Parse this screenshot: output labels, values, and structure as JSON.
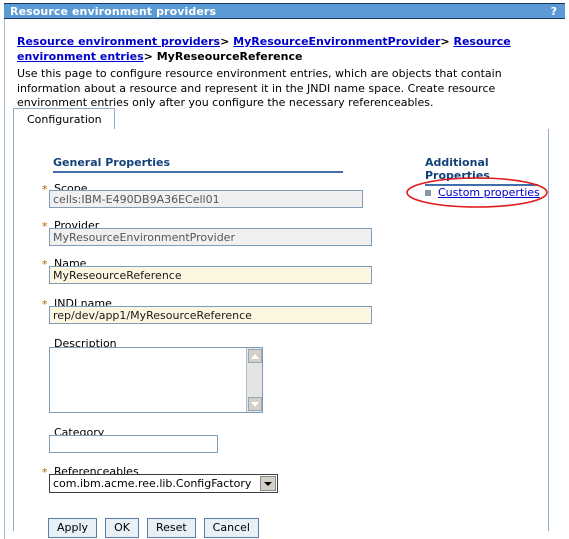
{
  "window": {
    "title": "Resource environment providers",
    "help_glyph": "?",
    "titlebar_color": "#5b9bd5"
  },
  "breadcrumb": {
    "items": [
      {
        "label": "Resource environment providers",
        "link": true
      },
      {
        "label": "MyResourceEnvironmentProvider",
        "link": true
      },
      {
        "label": "Resource environment entries",
        "link": true
      },
      {
        "label": "MyReseourceReference",
        "link": false
      }
    ],
    "separator": ">"
  },
  "intro": {
    "text": "Use this page to configure resource environment entries, which are objects that contain information about a resource and represent it in the JNDI name space. Create resource environment entries only after you configure the necessary referenceables."
  },
  "tabs": [
    {
      "label": "Configuration",
      "active": true
    }
  ],
  "general_properties": {
    "heading": "General Properties",
    "fields": [
      {
        "label": "Scope",
        "required": true,
        "required_marker": "*",
        "value": "cells:IBM-E490DB9A36ECell01",
        "state": "disabled"
      },
      {
        "label": "Provider",
        "required": true,
        "required_marker": "*",
        "value": "MyResourceEnvironmentProvider",
        "state": "disabled"
      },
      {
        "label": "Name",
        "required": true,
        "required_marker": "*",
        "value": "MyReseourceReference",
        "state": "required"
      },
      {
        "label": "JNDI name",
        "required": true,
        "required_marker": "*",
        "value": "rep/dev/app1/MyResourceReference",
        "state": "required"
      },
      {
        "label": "Description",
        "required": false,
        "required_marker": "",
        "value": "",
        "state": "textarea"
      },
      {
        "label": "Category",
        "required": false,
        "required_marker": "",
        "value": "",
        "state": "plain"
      },
      {
        "label": "Referenceables",
        "required": true,
        "required_marker": "*",
        "value": "com.ibm.acme.ree.lib.ConfigFactory",
        "state": "select"
      }
    ]
  },
  "additional_properties": {
    "heading": "Additional Properties",
    "links": [
      {
        "label": "Custom properties",
        "annotated": true
      }
    ]
  },
  "buttons": [
    {
      "label": "Apply"
    },
    {
      "label": "OK"
    },
    {
      "label": "Reset"
    },
    {
      "label": "Cancel"
    }
  ],
  "annotation": {
    "shape": "ellipse",
    "color": "#e01b1b",
    "targets": "Custom properties"
  },
  "colors": {
    "link": "#0000cc",
    "heading": "#13417a",
    "required_star": "#b35c00",
    "required_field_bg": "#fdf6e0",
    "disabled_field_bg": "#f0f0f0",
    "annotation": "#e01b1b"
  }
}
